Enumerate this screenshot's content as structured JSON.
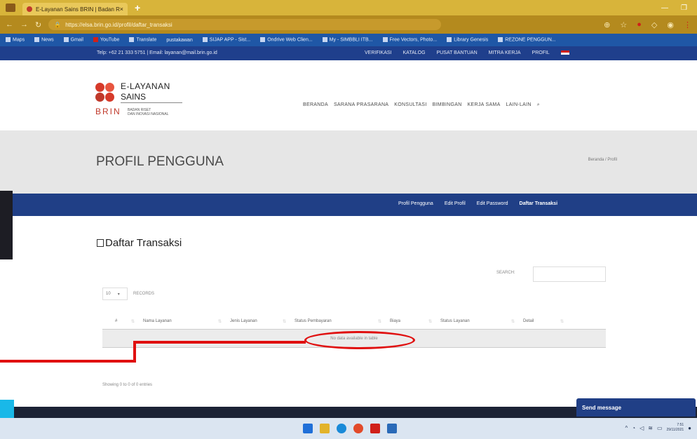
{
  "browser": {
    "tab_title": "E-Layanan Sains BRIN | Badan R...",
    "tab_close": "×",
    "new_tab": "+",
    "url": "https://elsa.brin.go.id/profil/daftar_transaksi",
    "bookmarks": [
      "Maps",
      "News",
      "Gmail",
      "YouTube",
      "Translate",
      "pustakawan",
      "SIJAP APP - Sist...",
      "Ondrive Web Clien...",
      "My - SIMBBLI ITB...",
      "Free Vectors, Photo...",
      "Library Genesis",
      "REZONE PENGGUN..."
    ]
  },
  "site": {
    "contact": "Telp: +62 21 333 5751 | Email: layanan@mail.brin.go.id",
    "topnav": [
      "VERIFIKASI",
      "KATALOG",
      "PUSAT BANTUAN",
      "MITRA KERJA",
      "PROFIL"
    ],
    "logo": {
      "line1": "E-LAYANAN",
      "line2": "SAINS",
      "brand": "BRIN",
      "sub1": "BADAN RISET",
      "sub2": "DAN INOVASI NASIONAL"
    },
    "mainnav": [
      "BERANDA",
      "SARANA PRASARANA",
      "KONSULTASI",
      "BIMBINGAN",
      "KERJA SAMA",
      "LAIN-LAIN"
    ]
  },
  "page": {
    "title": "PROFIL PENGGUNA",
    "breadcrumb": "Beranda / Profil",
    "subnav": [
      "Profil Pengguna",
      "Edit Profil",
      "Edit Password",
      "Daftar Transaksi"
    ],
    "section_title": "Daftar Transaksi"
  },
  "table": {
    "search_label": "SEARCH:",
    "length_value": "10",
    "length_label": "RECORDS",
    "columns": [
      "#",
      "Nama Layanan",
      "Jenis Layanan",
      "Status Pembayaran",
      "Biaya",
      "Status Layanan",
      "Detail"
    ],
    "empty_message": "No data available in table",
    "info": "Showing 0 to 0 of 0 entries"
  },
  "chat": {
    "send_message": "Send message"
  },
  "taskbar": {
    "time": "7:51",
    "date": "29/11/2021"
  },
  "colors": {
    "navy": "#203f86",
    "annotation_red": "#e01010",
    "browser_gold": "#d8b43a"
  }
}
